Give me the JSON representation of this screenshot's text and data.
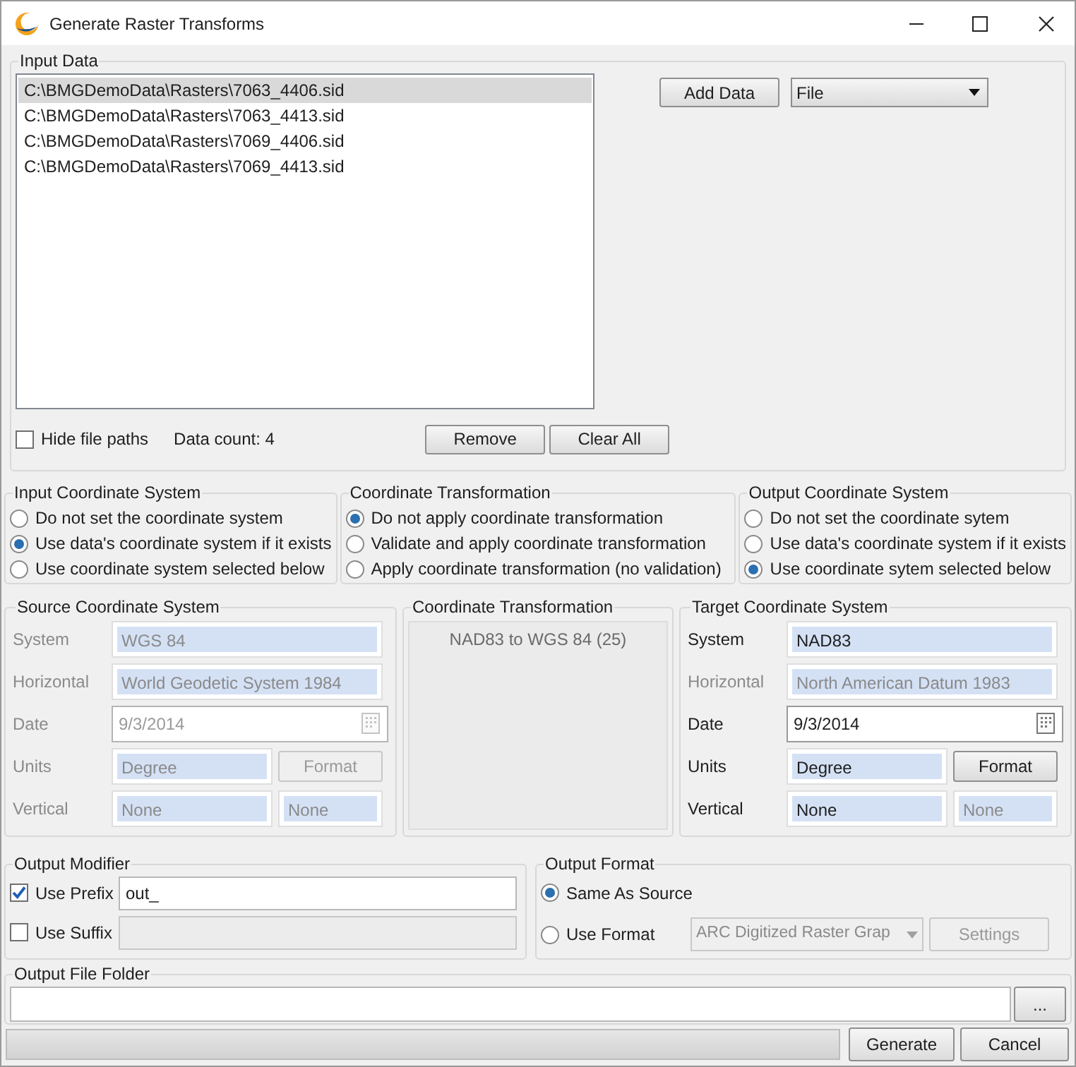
{
  "window": {
    "title": "Generate Raster Transforms"
  },
  "input_data": {
    "title": "Input Data",
    "files": [
      {
        "path": "C:\\BMGDemoData\\Rasters\\7063_4406.sid",
        "selected": true
      },
      {
        "path": "C:\\BMGDemoData\\Rasters\\7063_4413.sid",
        "selected": false
      },
      {
        "path": "C:\\BMGDemoData\\Rasters\\7069_4406.sid",
        "selected": false
      },
      {
        "path": "C:\\BMGDemoData\\Rasters\\7069_4413.sid",
        "selected": false
      }
    ],
    "add_button": "Add Data",
    "source_type": "File",
    "hide_file_paths": {
      "label": "Hide file paths",
      "checked": false
    },
    "data_count": "Data count: 4",
    "remove_button": "Remove",
    "clear_button": "Clear All"
  },
  "option_groups": [
    {
      "title": "Input Coordinate System",
      "options": [
        {
          "label": "Do not set the coordinate system",
          "selected": false
        },
        {
          "label": "Use data's coordinate system if it exists",
          "selected": true
        },
        {
          "label": "Use coordinate system selected below",
          "selected": false
        }
      ]
    },
    {
      "title": "Coordinate Transformation",
      "options": [
        {
          "label": "Do not apply coordinate transformation",
          "selected": true
        },
        {
          "label": "Validate and apply coordinate transformation",
          "selected": false
        },
        {
          "label": "Apply coordinate transformation (no validation)",
          "selected": false
        }
      ]
    },
    {
      "title": "Output Coordinate System",
      "options": [
        {
          "label": "Do not set the coordinate sytem",
          "selected": false
        },
        {
          "label": "Use data's coordinate system if it exists",
          "selected": false
        },
        {
          "label": "Use coordinate sytem selected below",
          "selected": true
        }
      ]
    }
  ],
  "source_system": {
    "title": "Source Coordinate System",
    "fields": [
      {
        "kind": "text",
        "label": "System",
        "value": "WGS 84",
        "enabled": false
      },
      {
        "kind": "text",
        "label": "Horizontal",
        "value": "World Geodetic System 1984",
        "enabled": false
      },
      {
        "kind": "date",
        "label": "Date",
        "value": "9/3/2014",
        "enabled": false
      },
      {
        "kind": "button",
        "label": "Units",
        "value": "Degree",
        "button": "Format",
        "enabled": false
      },
      {
        "kind": "pair",
        "label": "Vertical",
        "value": "None",
        "value_2": "None",
        "enabled": false
      }
    ]
  },
  "transformation": {
    "title": "Coordinate Transformation",
    "value": "NAD83 to WGS 84 (25)",
    "enabled": false
  },
  "target_system": {
    "title": "Target Coordinate System",
    "fields": [
      {
        "kind": "text",
        "label": "System",
        "value": "NAD83",
        "enabled": true
      },
      {
        "kind": "text",
        "label": "Horizontal",
        "value": "North American Datum 1983",
        "enabled": false
      },
      {
        "kind": "date",
        "label": "Date",
        "value": "9/3/2014",
        "enabled": true
      },
      {
        "kind": "button",
        "label": "Units",
        "value": "Degree",
        "button": "Format",
        "enabled": true
      },
      {
        "kind": "pair",
        "label": "Vertical",
        "value": "None",
        "value_2": "None",
        "enabled": true
      }
    ]
  },
  "output_modifier": {
    "title": "Output Modifier",
    "rows": [
      {
        "label": "Use Prefix",
        "checked": true,
        "value": "out_"
      },
      {
        "label": "Use Suffix",
        "checked": false
      }
    ]
  },
  "output_format": {
    "title": "Output Format",
    "options": [
      {
        "label": "Same As Source",
        "selected": true
      },
      {
        "label": "Use Format",
        "selected": false
      }
    ],
    "format": "ARC Digitized Raster Grap",
    "settings_button": "Settings"
  },
  "output_folder": {
    "title": "Output File Folder",
    "browse_button": "..."
  },
  "footer": {
    "progress": {
      "level": 0
    },
    "generate_button": "Generate",
    "cancel_button": "Cancel"
  }
}
